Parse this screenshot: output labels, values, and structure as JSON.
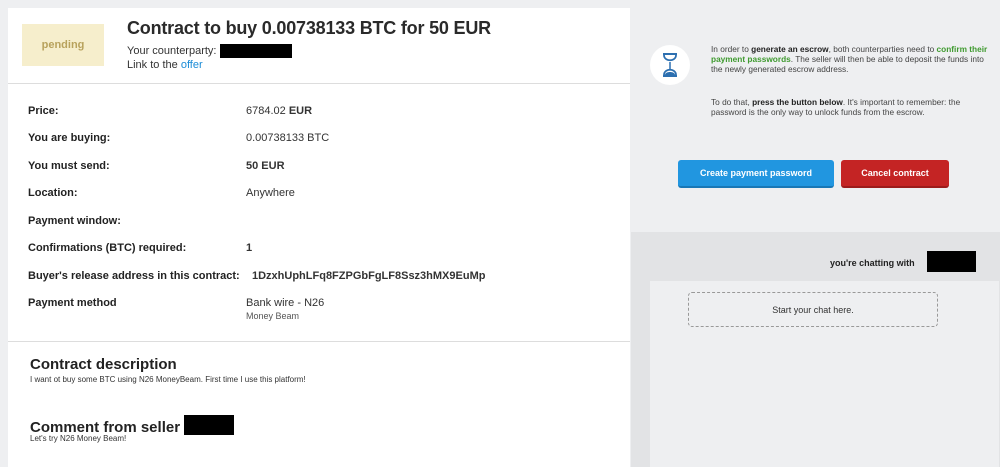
{
  "contract": {
    "status": "pending",
    "title_prefix": "Contract to buy 0.00738133 BTC for ",
    "title_amount": "50 EUR",
    "counterparty_label": "Your counterparty:",
    "link_prefix": "Link to the ",
    "link_text": "offer"
  },
  "details": [
    {
      "key": "Price:",
      "value": "6784.02",
      "currency": "EUR"
    },
    {
      "key": "You are buying:",
      "value": "0.00738133 BTC"
    },
    {
      "key": "You must send:",
      "value": "50 EUR"
    },
    {
      "key": "Location:",
      "value": "Anywhere"
    },
    {
      "key": "Payment window:",
      "value": ""
    },
    {
      "key": "Confirmations (BTC) required:",
      "value": "1"
    },
    {
      "key": "Buyer's release address in this contract:",
      "value": "1DzxhUphLFq8FZPGbFgLF8Ssz3hMX9EuMp"
    },
    {
      "key": "Payment method",
      "value": "Bank wire - N26",
      "sub": "Money Beam"
    }
  ],
  "description": {
    "title": "Contract description",
    "text": "I want ot buy some BTC using N26 MoneyBeam. First time I use this platform!"
  },
  "comment": {
    "title": "Comment from seller",
    "text": "Let's try N26 Money Beam!"
  },
  "escrow_info": {
    "p1_a": "In order to ",
    "p1_b": "generate an escrow",
    "p1_c": ", both counterparties need to ",
    "p1_d": "confirm their payment passwords",
    "p1_e": ". The seller will then be able to deposit the funds into the newly generated escrow address.",
    "p2_a": "To do that, ",
    "p2_b": "press the button below",
    "p2_c": ". It's important to remember: the password is the only way to unlock funds from the escrow."
  },
  "buttons": {
    "create_password": "Create payment password",
    "cancel_contract": "Cancel contract"
  },
  "chat": {
    "chatting_with": "you're chatting with",
    "start_chat": "Start your chat here."
  },
  "icons": {
    "escrow": "hourglass-icon"
  },
  "colors": {
    "status_bg": "#f6eecc",
    "status_text": "#b8a25c",
    "link": "#1a8bd6",
    "accent_green": "#3f9a2f",
    "primary_button": "#2196e0",
    "danger_button": "#c42424"
  }
}
